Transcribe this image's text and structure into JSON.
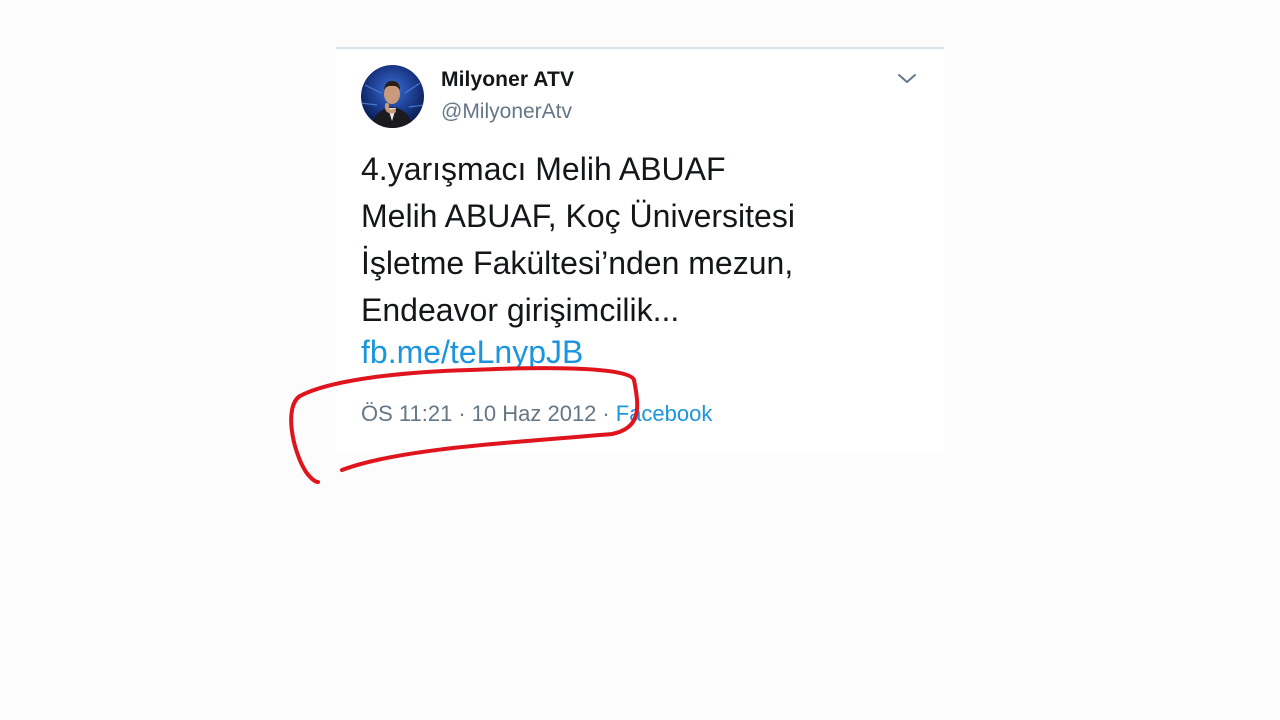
{
  "tweet": {
    "author": {
      "display_name": "Milyoner ATV",
      "handle": "@MilyonerAtv"
    },
    "text_lines": [
      "4.yarışmacı Melih ABUAF",
      "Melih ABUAF, Koç Üniversitesi",
      "İşletme Fakültesi’nden mezun,",
      "Endeavor girişimcilik..."
    ],
    "link": "fb.me/teLnypJB",
    "meta": {
      "time": "ÖS 11:21",
      "separator": "·",
      "date": "10 Haz 2012",
      "source": "Facebook"
    }
  },
  "colors": {
    "text": "#14171a",
    "secondary": "#657786",
    "link": "#1b95e0",
    "annotation": "#e0141c"
  },
  "icons": {
    "caret": "chevron-down-icon",
    "avatar": "profile-photo"
  }
}
